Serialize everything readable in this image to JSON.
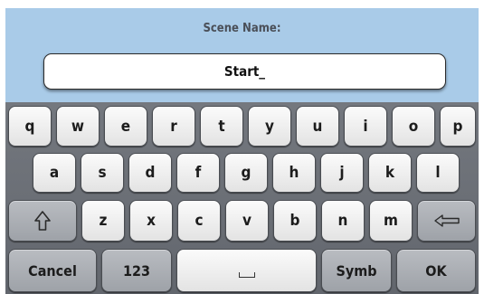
{
  "header": {
    "title": "Scene Name:",
    "field_value": "Start_"
  },
  "keyboard": {
    "row1": [
      "q",
      "w",
      "e",
      "r",
      "t",
      "y",
      "u",
      "i",
      "o",
      "p"
    ],
    "row2": [
      "a",
      "s",
      "d",
      "f",
      "g",
      "h",
      "j",
      "k",
      "l"
    ],
    "row3": [
      "z",
      "x",
      "c",
      "v",
      "b",
      "n",
      "m"
    ],
    "cancel_label": "Cancel",
    "numbers_label": "123",
    "symbols_label": "Symb",
    "ok_label": "OK",
    "icons": {
      "shift": "shift-icon",
      "backspace": "backspace-icon",
      "space": "space-icon"
    }
  },
  "colors": {
    "header_bg": "#a9cbe8",
    "keyboard_bg": "#6b6f76",
    "key_light": "#f2f2f2",
    "key_dark": "#aeb1b6"
  }
}
